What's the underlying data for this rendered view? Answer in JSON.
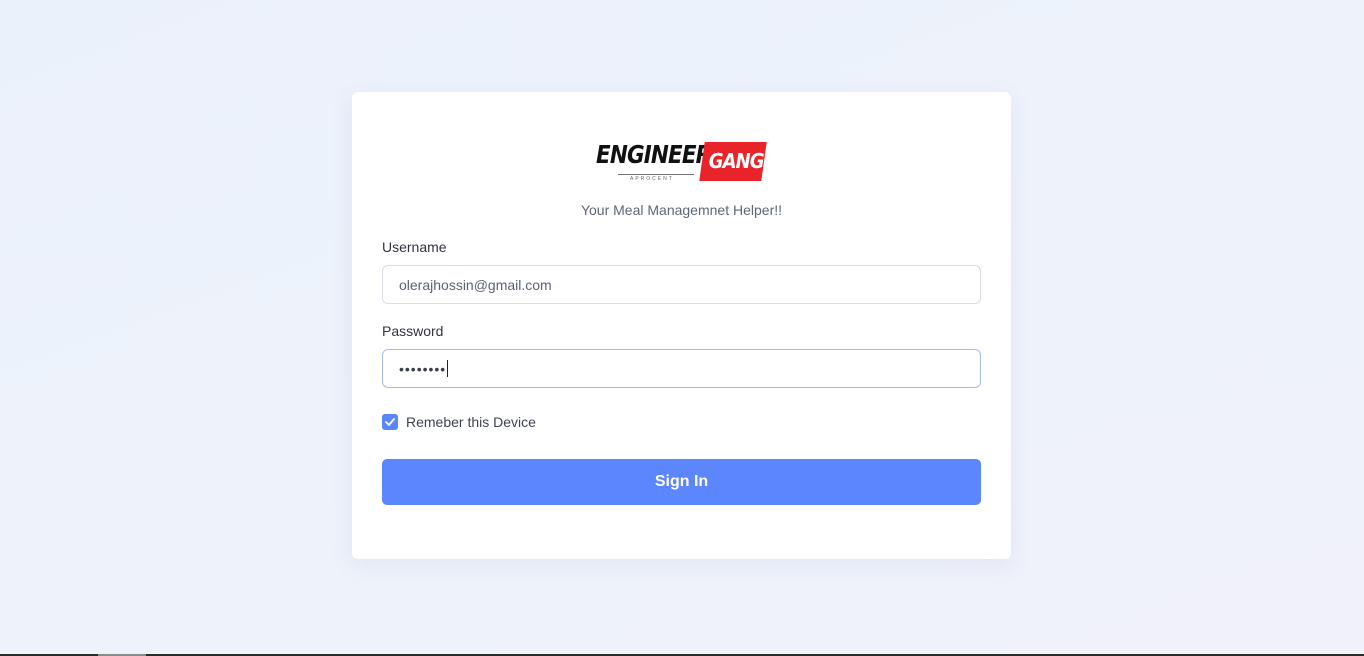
{
  "brand": {
    "logo_primary": "ENGINEER",
    "logo_accent": "GANG",
    "logo_sub": "APROCENT",
    "accent_color": "#e8232a"
  },
  "tagline": "Your Meal Managemnet Helper!!",
  "form": {
    "username_label": "Username",
    "username_value": "olerajhossin@gmail.com",
    "password_label": "Password",
    "password_masked": "••••••••",
    "remember_label": "Remeber this Device",
    "remember_checked": true,
    "submit_label": "Sign In",
    "primary_color": "#5b86fd"
  }
}
